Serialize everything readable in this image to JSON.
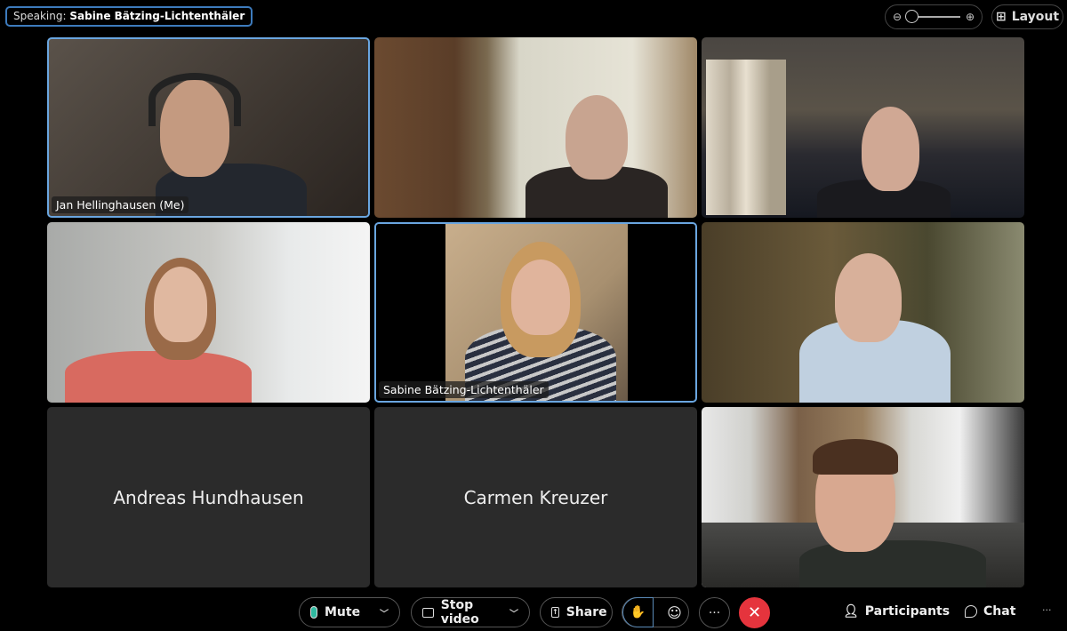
{
  "header": {
    "speaking_label": "Speaking:",
    "speaking_name": "Sabine Bätzing-Lichtenthäler",
    "layout_label": "Layout",
    "zoom_level": 0
  },
  "tiles": [
    {
      "name": "Jan Hellinghausen (Me)",
      "video": true,
      "active": true
    },
    {
      "name": "",
      "video": true,
      "active": false
    },
    {
      "name": "",
      "video": true,
      "active": false
    },
    {
      "name": "",
      "video": true,
      "active": false
    },
    {
      "name": "Sabine Bätzing-Lichtenthäler",
      "video": true,
      "active": true
    },
    {
      "name": "",
      "video": true,
      "active": false
    },
    {
      "name": "Andreas Hundhausen",
      "video": false
    },
    {
      "name": "Carmen Kreuzer",
      "video": false
    },
    {
      "name": "",
      "video": true,
      "active": false
    }
  ],
  "toolbar": {
    "mute": "Mute",
    "stop_video": "Stop video",
    "share": "Share",
    "more": "···",
    "participants": "Participants",
    "chat": "Chat",
    "overflow": "···"
  },
  "colors": {
    "accent": "#6aa6e0",
    "end_call": "#e5343d",
    "mic_active": "#2fb9a0"
  }
}
